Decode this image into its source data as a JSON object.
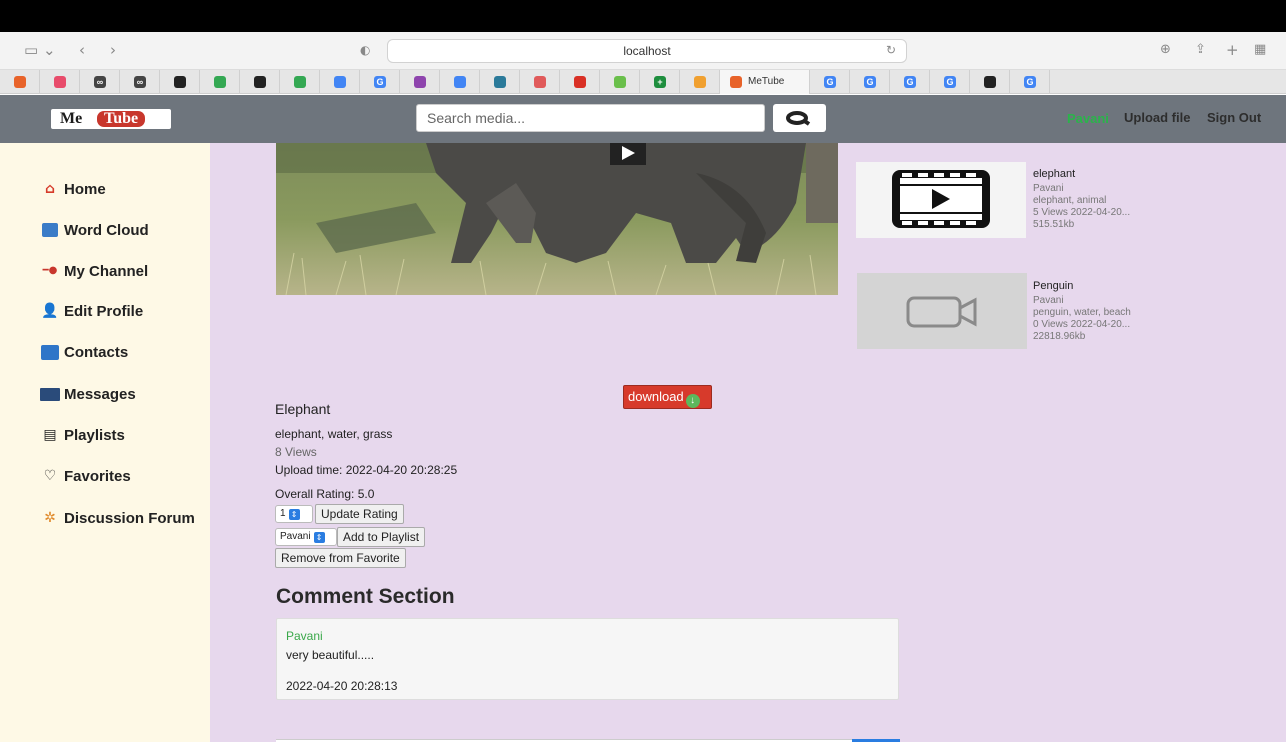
{
  "browser": {
    "url": "localhost",
    "active_tab_title": "MeTube",
    "tab_favicons": [
      {
        "name": "tab-favicon-1",
        "color": "#e8632a",
        "glyph": ""
      },
      {
        "name": "tab-favicon-2",
        "color": "#e84c6b",
        "glyph": ""
      },
      {
        "name": "tab-favicon-3",
        "color": "#444444",
        "glyph": "∞"
      },
      {
        "name": "tab-favicon-4",
        "color": "#444444",
        "glyph": "∞"
      },
      {
        "name": "tab-favicon-github",
        "color": "#222222",
        "glyph": ""
      },
      {
        "name": "tab-favicon-drive",
        "color": "#34a853",
        "glyph": ""
      },
      {
        "name": "tab-favicon-github-2",
        "color": "#222222",
        "glyph": ""
      },
      {
        "name": "tab-favicon-drive-2",
        "color": "#34a853",
        "glyph": ""
      },
      {
        "name": "tab-favicon-docs",
        "color": "#4285f4",
        "glyph": ""
      },
      {
        "name": "tab-favicon-google",
        "color": "#4285f4",
        "glyph": "G"
      },
      {
        "name": "tab-favicon-purple",
        "color": "#8e44ad",
        "glyph": ""
      },
      {
        "name": "tab-favicon-docs-2",
        "color": "#4285f4",
        "glyph": ""
      },
      {
        "name": "tab-favicon-teal",
        "color": "#2b7a9a",
        "glyph": ""
      },
      {
        "name": "tab-favicon-red",
        "color": "#e05a5a",
        "glyph": ""
      },
      {
        "name": "tab-favicon-red-2",
        "color": "#d93025",
        "glyph": ""
      },
      {
        "name": "tab-favicon-green",
        "color": "#6abf4b",
        "glyph": ""
      },
      {
        "name": "tab-favicon-plus",
        "color": "#1e8e3e",
        "glyph": "+"
      },
      {
        "name": "tab-favicon-orange",
        "color": "#f0a030",
        "glyph": ""
      }
    ],
    "right_tab_favicons": [
      {
        "name": "tab-favicon-google-2",
        "color": "#4285f4",
        "glyph": "G"
      },
      {
        "name": "tab-favicon-google-3",
        "color": "#4285f4",
        "glyph": "G"
      },
      {
        "name": "tab-favicon-google-4",
        "color": "#4285f4",
        "glyph": "G"
      },
      {
        "name": "tab-favicon-google-5",
        "color": "#4285f4",
        "glyph": "G"
      },
      {
        "name": "tab-favicon-dark",
        "color": "#222222",
        "glyph": ""
      },
      {
        "name": "tab-favicon-google-6",
        "color": "#4285f4",
        "glyph": "G"
      }
    ]
  },
  "navbar": {
    "logo_me": "Me",
    "logo_tube": "Tube",
    "search_placeholder": "Search media...",
    "user": "Pavani",
    "upload": "Upload file",
    "signout": "Sign Out"
  },
  "sidebar": {
    "items": [
      {
        "label": "Home",
        "icon": "home-icon"
      },
      {
        "label": "Word Cloud",
        "icon": "word-cloud-icon"
      },
      {
        "label": "My Channel",
        "icon": "channel-icon"
      },
      {
        "label": "Edit Profile",
        "icon": "edit-profile-icon"
      },
      {
        "label": "Contacts",
        "icon": "contacts-icon"
      },
      {
        "label": "Messages",
        "icon": "messages-icon"
      },
      {
        "label": "Playlists",
        "icon": "playlist-icon"
      },
      {
        "label": "Favorites",
        "icon": "favorites-icon"
      },
      {
        "label": "Discussion Forum",
        "icon": "forum-icon"
      }
    ]
  },
  "video": {
    "download_label": "download",
    "title": "Elephant",
    "tags": "elephant, water, grass",
    "views": "8 Views",
    "upload_time": "Upload time: 2022-04-20 20:28:25",
    "rating": "Overall Rating: 5.0",
    "rating_select": "1",
    "update_rating": "Update Rating",
    "playlist_select": "Pavani",
    "add_playlist": "Add to Playlist",
    "remove_favorite": "Remove from Favorite"
  },
  "comments": {
    "heading": "Comment Section",
    "items": [
      {
        "user": "Pavani",
        "text": "very beautiful.....",
        "time": "2022-04-20 20:28:13"
      }
    ]
  },
  "related": [
    {
      "title": "elephant",
      "user": "Pavani",
      "tags": "elephant, animal",
      "views_date": "5 Views 2022-04-20...",
      "size": "515.51kb"
    },
    {
      "title": "Penguin",
      "user": "Pavani",
      "tags": "penguin, water, beach",
      "views_date": "0 Views 2022-04-20...",
      "size": "22818.96kb"
    }
  ]
}
